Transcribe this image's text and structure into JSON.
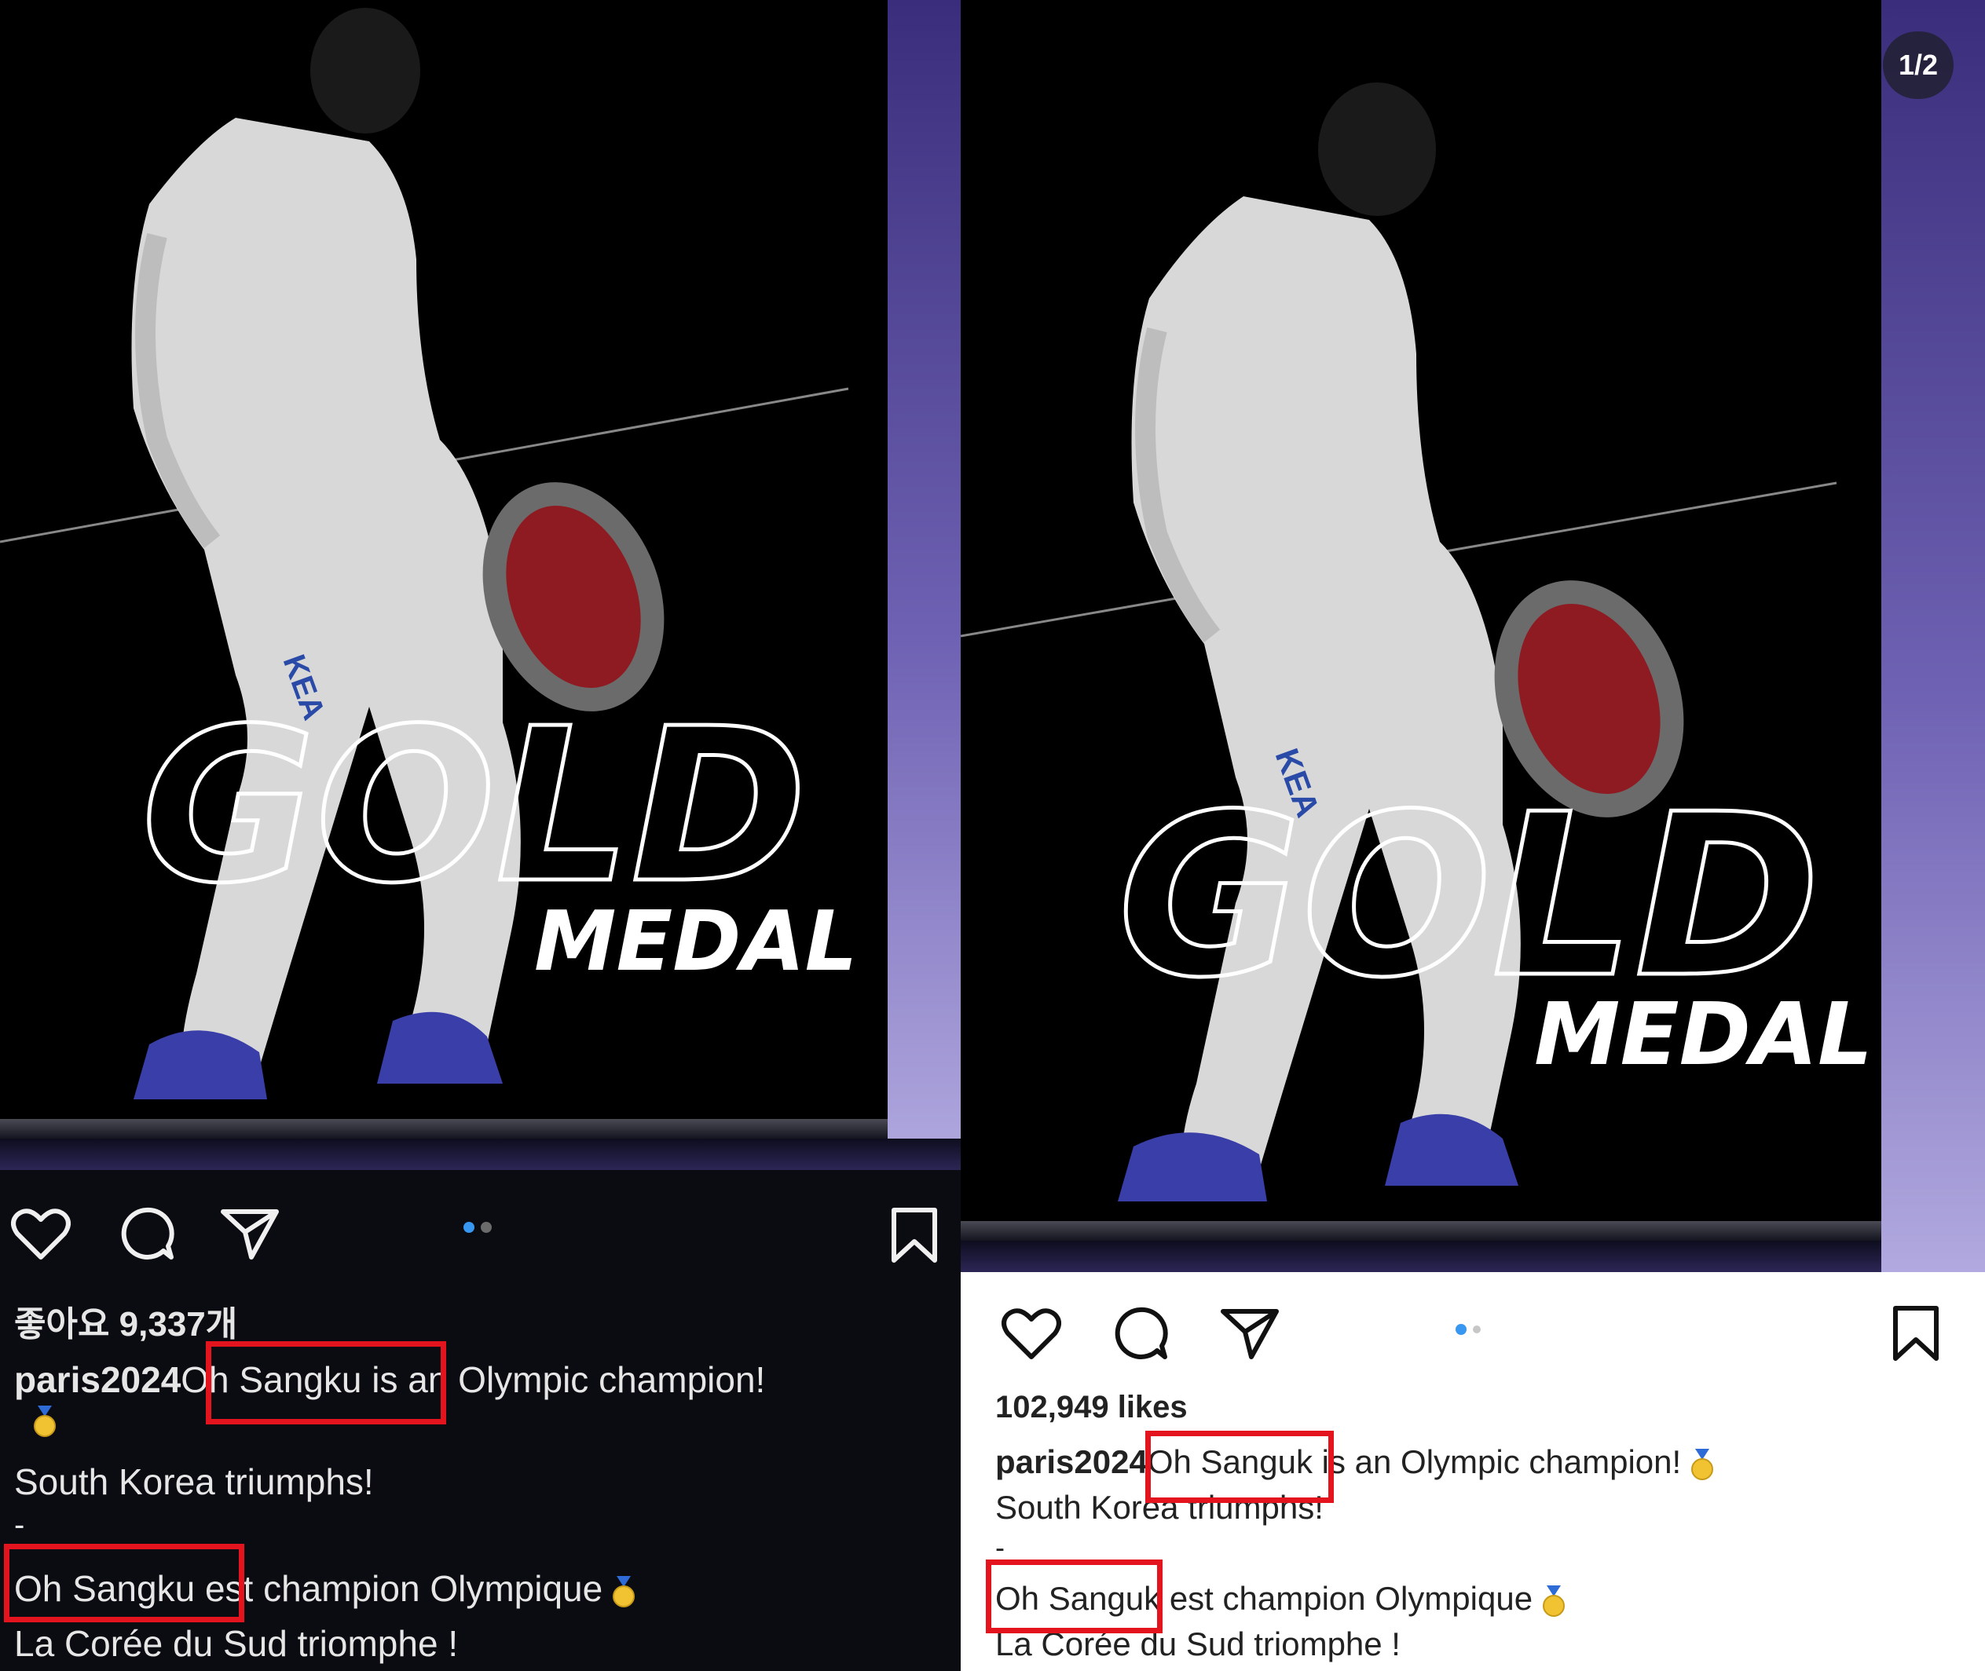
{
  "left": {
    "graphic": {
      "gold_word": "GOLD",
      "medal_word": "MEDAL",
      "jersey_text": "KEA"
    },
    "likes": "좋아요 9,337개",
    "username": "paris2024",
    "caption_name": "Oh Sangku",
    "caption_rest": " is an Olympic champion!",
    "line2": "South Korea triumphs!",
    "dash": "-",
    "fr_name": "Oh Sangku",
    "fr_rest": " est champion Olympique",
    "fr_line2": "La Corée du Sud triomphe !",
    "theme": "dark"
  },
  "right": {
    "graphic": {
      "gold_word": "GOLD",
      "medal_word": "MEDAL",
      "jersey_text": "KEA"
    },
    "counter": "1/2",
    "likes": "102,949 likes",
    "username": "paris2024",
    "caption_name": "Oh Sanguk",
    "caption_rest": " is an Olympic champion!",
    "line2": "South Korea triumphs!",
    "dash": "-",
    "fr_name": "Oh Sanguk",
    "fr_rest": " est champion Olympique",
    "fr_line2": "La Corée du Sud triomphe !",
    "theme": "light"
  },
  "colors": {
    "highlight": "#e3141e",
    "dot_active": "#3897f0",
    "dark_bg": "#0b0b12",
    "light_bg": "#ffffff",
    "medal": "#f1c232"
  },
  "icons": [
    "heart-icon",
    "comment-icon",
    "share-icon",
    "bookmark-icon",
    "medal-emoji-icon"
  ]
}
